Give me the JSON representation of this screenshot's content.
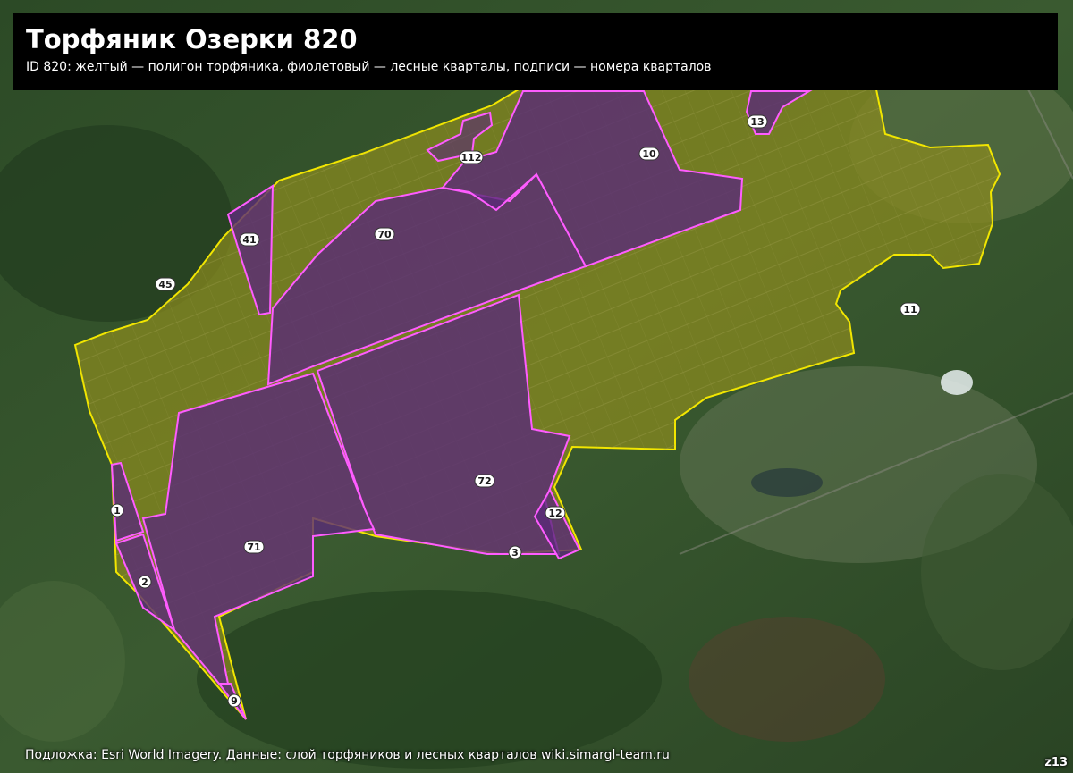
{
  "map": {
    "title": "Торфяник Озерки 820",
    "subtitle": "ID 820: желтый — полигон торфяника, фиолетовый — лесные кварталы, подписи — номера кварталов",
    "attribution": "Подложка: Esri World Imagery. Данные: слой торфяников и лесных кварталов wiki.simargl-team.ru",
    "zoom_label": "z13",
    "colors": {
      "peat_fill": "#8a8a1e",
      "peat_outline": "#f2e600",
      "quarter_fill": "#5a2a78",
      "quarter_outline": "#ff5cff",
      "label_bg": "#ffffff"
    },
    "quarter_labels": [
      "112",
      "10",
      "13",
      "70",
      "41",
      "45",
      "11",
      "72",
      "71",
      "12",
      "1",
      "2",
      "3",
      "9"
    ]
  }
}
